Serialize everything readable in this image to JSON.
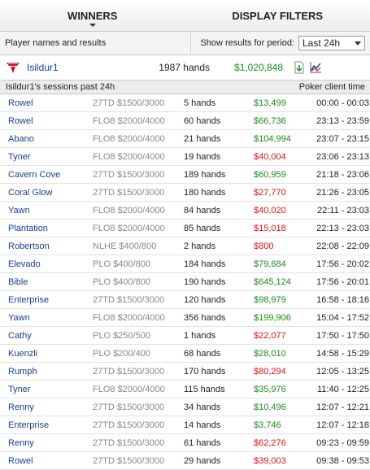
{
  "tabs": {
    "winners": "WINNERS",
    "display_filters": "DISPLAY FILTERS"
  },
  "filters": {
    "left_label": "Player names and results",
    "period_label": "Show results for period:",
    "period_value": "Last 24h"
  },
  "summary": {
    "player": "Isildur1",
    "hands": "1987 hands",
    "total": "$1,020,848"
  },
  "sessions_header": {
    "title": "Isildur1's sessions past 24h",
    "time_label": "Poker client time"
  },
  "colors": {
    "positive": "#1a8c1a",
    "negative": "#e01010",
    "link": "#1a3e8c"
  },
  "icons": {
    "logo": "fulltilt-logo-icon",
    "download": "download-icon",
    "graph": "graph-icon"
  },
  "sessions": [
    {
      "name": "Rowel",
      "game": "27TD $1500/3000",
      "hands": "5 hands",
      "amount": "$13,499",
      "sign": "pos",
      "time": "00:00 - 00:03"
    },
    {
      "name": "Rowel",
      "game": "FLO8 $2000/4000",
      "hands": "60 hands",
      "amount": "$66,736",
      "sign": "pos",
      "time": "23:13 - 23:59"
    },
    {
      "name": "Abano",
      "game": "FLO8 $2000/4000",
      "hands": "21 hands",
      "amount": "$104,994",
      "sign": "pos",
      "time": "23:07 - 23:15"
    },
    {
      "name": "Tyner",
      "game": "FLO8 $2000/4000",
      "hands": "19 hands",
      "amount": "$40,004",
      "sign": "neg",
      "time": "23:06 - 23:13"
    },
    {
      "name": "Cavern Cove",
      "game": "27TD $1500/3000",
      "hands": "189 hands",
      "amount": "$60,959",
      "sign": "pos",
      "time": "21:18 - 23:06"
    },
    {
      "name": "Coral Glow",
      "game": "27TD $1500/3000",
      "hands": "180 hands",
      "amount": "$27,770",
      "sign": "neg",
      "time": "21:26 - 23:05"
    },
    {
      "name": "Yawn",
      "game": "FLO8 $2000/4000",
      "hands": "84 hands",
      "amount": "$40,020",
      "sign": "neg",
      "time": "22:11 - 23:03"
    },
    {
      "name": "Plantation",
      "game": "FLO8 $2000/4000",
      "hands": "85 hands",
      "amount": "$15,018",
      "sign": "neg",
      "time": "22:13 - 23:03"
    },
    {
      "name": "Robertson",
      "game": "NLHE $400/800",
      "hands": "2 hands",
      "amount": "$800",
      "sign": "neg",
      "time": "22:08 - 22:09"
    },
    {
      "name": "Elevado",
      "game": "PLO $400/800",
      "hands": "184 hands",
      "amount": "$79,684",
      "sign": "pos",
      "time": "17:56 - 20:02"
    },
    {
      "name": "Bible",
      "game": "PLO $400/800",
      "hands": "190 hands",
      "amount": "$645,124",
      "sign": "pos",
      "time": "17:56 - 20:01"
    },
    {
      "name": "Enterprise",
      "game": "27TD $1500/3000",
      "hands": "120 hands",
      "amount": "$98,979",
      "sign": "pos",
      "time": "16:58 - 18:16"
    },
    {
      "name": "Yawn",
      "game": "FLO8 $2000/4000",
      "hands": "356 hands",
      "amount": "$199,906",
      "sign": "pos",
      "time": "15:04 - 17:52"
    },
    {
      "name": "Cathy",
      "game": "PLO $250/500",
      "hands": "1 hands",
      "amount": "$22,077",
      "sign": "neg",
      "time": "17:50 - 17:50"
    },
    {
      "name": "Kuenzli",
      "game": "PLO $200/400",
      "hands": "68 hands",
      "amount": "$28,010",
      "sign": "pos",
      "time": "14:58 - 15:29"
    },
    {
      "name": "Rumph",
      "game": "27TD $1500/3000",
      "hands": "170 hands",
      "amount": "$80,294",
      "sign": "neg",
      "time": "12:05 - 13:25"
    },
    {
      "name": "Tyner",
      "game": "FLO8 $2000/4000",
      "hands": "115 hands",
      "amount": "$35,976",
      "sign": "pos",
      "time": "11:40 - 12:25"
    },
    {
      "name": "Renny",
      "game": "27TD $1500/3000",
      "hands": "34 hands",
      "amount": "$10,496",
      "sign": "pos",
      "time": "12:07 - 12:21"
    },
    {
      "name": "Enterprise",
      "game": "27TD $1500/3000",
      "hands": "14 hands",
      "amount": "$3,746",
      "sign": "pos",
      "time": "12:07 - 12:18"
    },
    {
      "name": "Renny",
      "game": "27TD $1500/3000",
      "hands": "61 hands",
      "amount": "$62,276",
      "sign": "neg",
      "time": "09:23 - 09:59"
    },
    {
      "name": "Rowel",
      "game": "27TD $1500/3000",
      "hands": "29 hands",
      "amount": "$39,003",
      "sign": "neg",
      "time": "09:38 - 09:53"
    }
  ]
}
